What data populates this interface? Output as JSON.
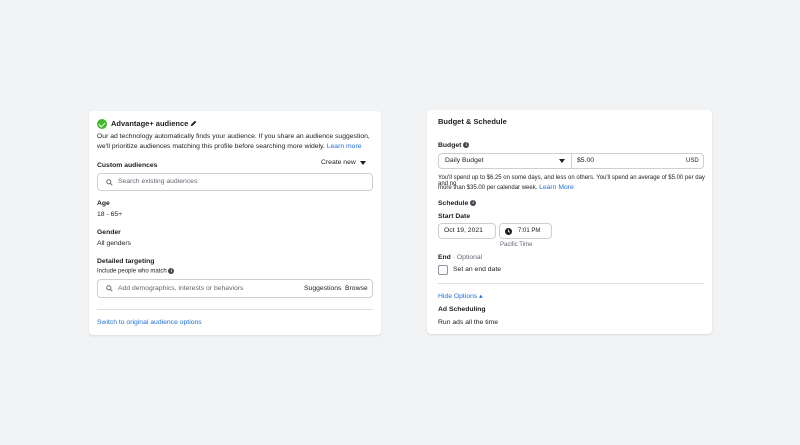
{
  "audience": {
    "title": "Advantage+ audience",
    "description_line1": "Our ad technology automatically finds your audience. If you share an audience suggestion,",
    "description_line2": "we'll prioritize audiences matching this profile before searching more widely.",
    "learn_more": "Learn more",
    "custom_audiences_label": "Custom audiences",
    "create_new": "Create new",
    "search_placeholder": "Search existing audiences",
    "age_label": "Age",
    "age_value": "18 - 65+",
    "gender_label": "Gender",
    "gender_value": "All genders",
    "detailed_targeting_label": "Detailed targeting",
    "include_label": "Include people who match",
    "targeting_placeholder": "Add demographics, interests or behaviors",
    "suggestions": "Suggestions",
    "browse": "Browse",
    "switch_link": "Switch to original audience options"
  },
  "budget": {
    "title": "Budget & Schedule",
    "budget_label": "Budget",
    "budget_type": "Daily Budget",
    "amount": "$5.00",
    "currency": "USD",
    "note_line1": "You'll spend up to $6.25 on some days, and less on others. You'll spend an average of $5.00 per day and no",
    "note_line2": "more than $35.00 per calendar week.",
    "learn_more": "Learn More",
    "schedule_label": "Schedule",
    "start_date_label": "Start Date",
    "start_date": "Oct 19, 2021",
    "start_time": "7:01 PM",
    "timezone": "Pacific Time",
    "end_label": "End",
    "end_optional": " · Optional",
    "set_end_date": "Set an end date",
    "hide_options": "Hide Options ▴",
    "ad_scheduling_label": "Ad Scheduling",
    "ad_scheduling_value": "Run ads all the time"
  },
  "colors": {
    "link": "#216fdb",
    "check": "#42b72a",
    "background": "#f2f3f5"
  }
}
